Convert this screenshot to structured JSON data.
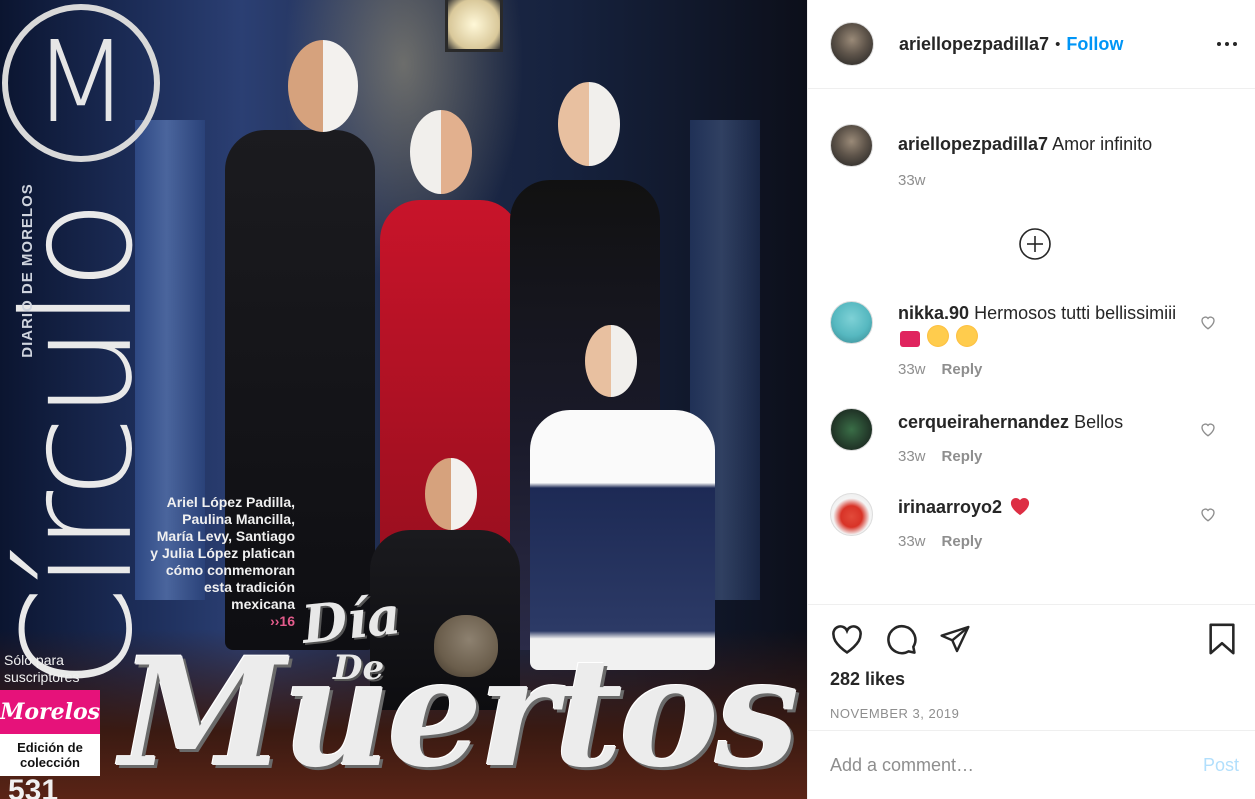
{
  "media": {
    "logo_letter": "M",
    "brand_vertical": "Círculo",
    "brand_subtitle": "DIARIO DE MORELOS",
    "blurb": "Ariel López Padilla, Paulina Mancilla, María Levy, Santiago y Julia López platican cómo conmemoran esta tradición mexicana",
    "blurb_ref": "››16",
    "headline_1": "Día",
    "headline_2": "De",
    "headline_3": "Muertos",
    "subscribers": "Sólo para suscriptores",
    "paper_name": "Morelos",
    "edition": "Edición de colección",
    "issue_number": "531"
  },
  "header": {
    "username": "ariellopezpadilla7",
    "separator": "•",
    "follow_label": "Follow"
  },
  "caption": {
    "username": "ariellopezpadilla7",
    "text": "Amor infinito",
    "time": "33w"
  },
  "comments": [
    {
      "username": "nikka.90",
      "text": "Hermosos tutti bellissimiii",
      "emojis": [
        "hundred-points",
        "star-struck",
        "face-blowing-kiss"
      ],
      "time": "33w",
      "reply_label": "Reply"
    },
    {
      "username": "cerqueirahernandez",
      "text": "Bellos",
      "emojis": [],
      "time": "33w",
      "reply_label": "Reply"
    },
    {
      "username": "irinaarroyo2",
      "text": "",
      "emojis": [
        "red-heart"
      ],
      "time": "33w",
      "reply_label": "Reply"
    }
  ],
  "footer": {
    "likes": "282 likes",
    "date": "NOVEMBER 3, 2019",
    "comment_placeholder": "Add a comment…",
    "post_label": "Post"
  },
  "colors": {
    "accent_blue": "#0095f6",
    "post_disabled": "#b2dffc",
    "muted_text": "#8e8e8e",
    "heart_red": "#e0245e",
    "magazine_pink": "#e6127a"
  }
}
